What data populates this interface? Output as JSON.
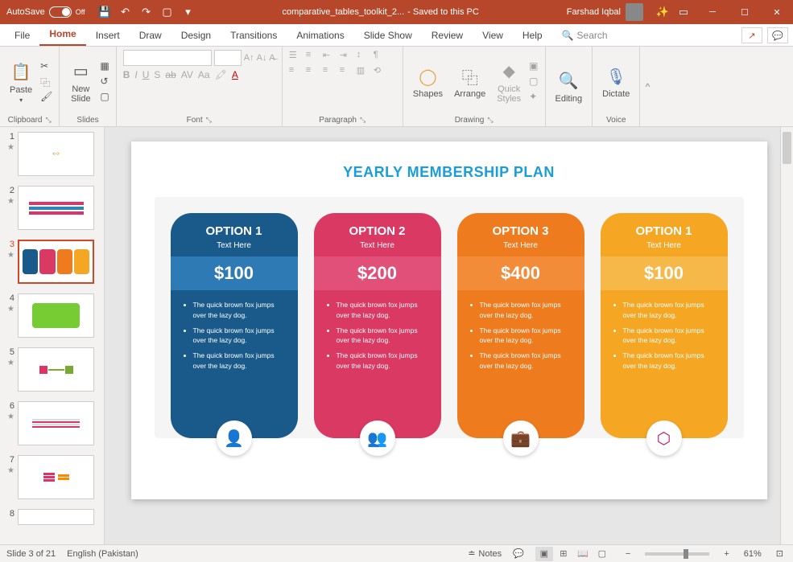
{
  "title": {
    "autosave": "AutoSave",
    "autosave_state": "Off",
    "filename": "comparative_tables_toolkit_2...",
    "saved": "- Saved to this PC",
    "user": "Farshad Iqbal"
  },
  "menu": {
    "file": "File",
    "home": "Home",
    "insert": "Insert",
    "draw": "Draw",
    "design": "Design",
    "transitions": "Transitions",
    "animations": "Animations",
    "slideshow": "Slide Show",
    "review": "Review",
    "view": "View",
    "help": "Help",
    "search": "Search"
  },
  "ribbon": {
    "clipboard": "Clipboard",
    "paste": "Paste",
    "slides": "Slides",
    "newslide": "New\nSlide",
    "font": "Font",
    "b": "B",
    "i": "I",
    "u": "U",
    "s": "S",
    "ab": "ab",
    "av": "AV",
    "aa": "Aa",
    "a1": "A",
    "a2": "A",
    "paragraph": "Paragraph",
    "drawing": "Drawing",
    "shapes": "Shapes",
    "arrange": "Arrange",
    "quick": "Quick\nStyles",
    "editing": "Editing",
    "voice": "Voice",
    "dictate": "Dictate"
  },
  "slide": {
    "title": "YEARLY MEMBERSHIP PLAN",
    "cards": [
      {
        "option": "OPTION 1",
        "sub": "Text Here",
        "price": "$100",
        "b1": "The quick brown fox jumps over the lazy dog.",
        "b2": "The quick brown fox jumps over the lazy dog.",
        "b3": "The quick brown fox jumps over the lazy dog."
      },
      {
        "option": "OPTION 2",
        "sub": "Text Here",
        "price": "$200",
        "b1": "The quick brown fox jumps over the lazy dog.",
        "b2": "The quick brown fox jumps over the lazy dog.",
        "b3": "The quick brown fox jumps over the lazy dog."
      },
      {
        "option": "OPTION 3",
        "sub": "Text Here",
        "price": "$400",
        "b1": "The quick brown fox jumps over the lazy dog.",
        "b2": "The quick brown fox jumps over the lazy dog.",
        "b3": "The quick brown fox jumps over the lazy dog."
      },
      {
        "option": "OPTION 1",
        "sub": "Text Here",
        "price": "$100",
        "b1": "The quick brown fox jumps over the lazy dog.",
        "b2": "The quick brown fox jumps over the lazy dog.",
        "b3": "The quick brown fox jumps over the lazy dog."
      }
    ]
  },
  "thumbs": {
    "n1": "1",
    "n2": "2",
    "n3": "3",
    "n4": "4",
    "n5": "5",
    "n6": "6",
    "n7": "7",
    "n8": "8"
  },
  "status": {
    "slide": "Slide 3 of 21",
    "lang": "English (Pakistan)",
    "notes": "Notes",
    "comments": "",
    "zoom": "61%",
    "minus": "−",
    "plus": "+"
  }
}
